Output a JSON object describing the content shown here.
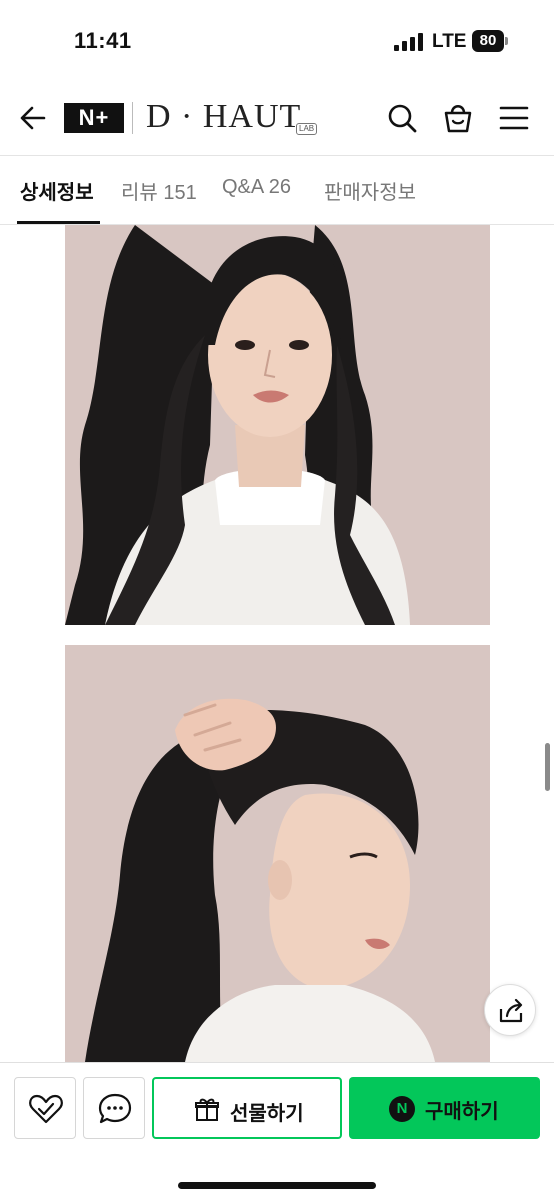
{
  "status_bar": {
    "time": "11:41",
    "carrier": "LTE",
    "battery": "80"
  },
  "header": {
    "nplus_logo": "N+",
    "brand": "D · HAUT",
    "brand_sub": "LAB"
  },
  "tabs": [
    {
      "label": "상세정보",
      "active": true
    },
    {
      "label": "리뷰 151",
      "active": false
    },
    {
      "label": "Q&A 26",
      "active": false
    },
    {
      "label": "판매자정보",
      "active": false
    }
  ],
  "bottom_bar": {
    "gift_label": "선물하기",
    "buy_label": "구매하기",
    "buy_badge": "N"
  },
  "colors": {
    "accent": "#03c75a",
    "photo_bg": "#d8c6c2",
    "text": "#111111"
  },
  "icons": [
    "back-arrow-icon",
    "search-icon",
    "shopping-bag-icon",
    "menu-icon",
    "heart-check-icon",
    "chat-bubble-icon",
    "gift-icon",
    "share-icon"
  ]
}
